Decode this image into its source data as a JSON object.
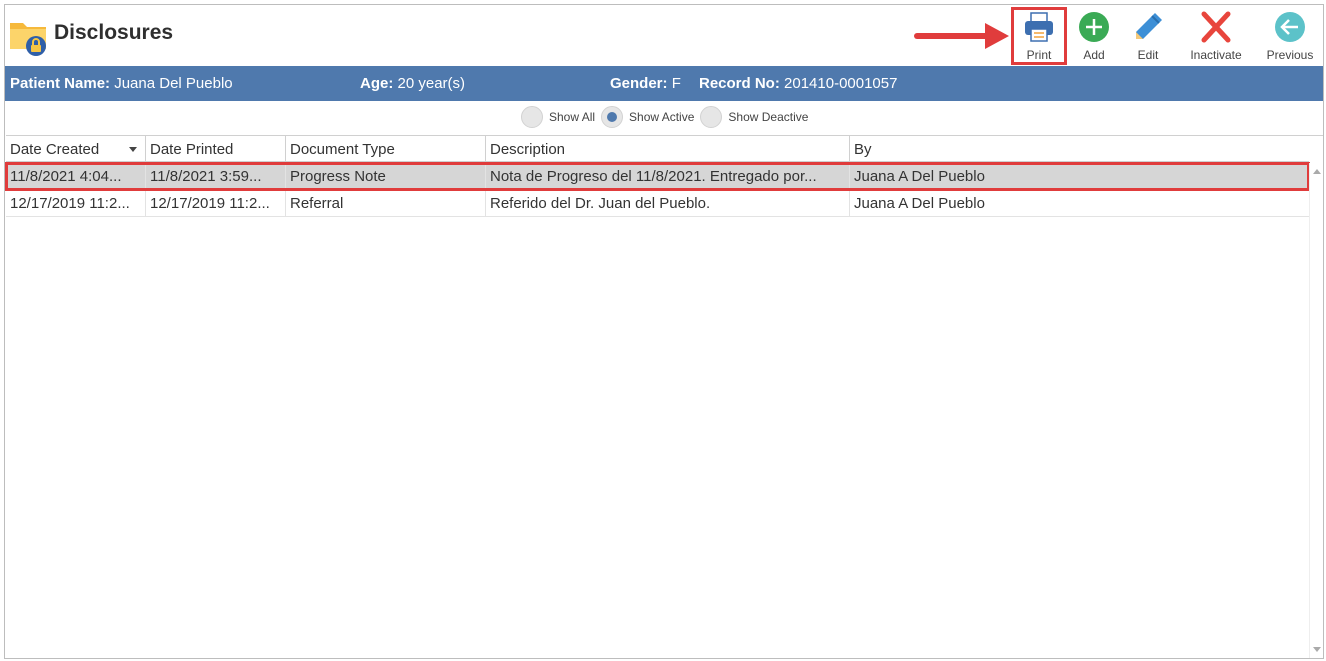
{
  "header": {
    "title": "Disclosures"
  },
  "toolbar": {
    "print_label": "Print",
    "add_label": "Add",
    "edit_label": "Edit",
    "inactivate_label": "Inactivate",
    "previous_label": "Previous",
    "icons": {
      "print": "printer-icon",
      "add": "plus-circle-icon",
      "edit": "pencil-icon",
      "inactivate": "x-icon",
      "previous": "arrow-left-circle-icon"
    }
  },
  "patient": {
    "name_label": "Patient Name:",
    "name_value": "Juana Del Pueblo",
    "age_label": "Age:",
    "age_value": "20 year(s)",
    "gender_label": "Gender:",
    "gender_value": "F",
    "record_label": "Record No:",
    "record_value": "201410-0001057"
  },
  "filters": {
    "options": [
      "Show All",
      "Show Active",
      "Show Deactive"
    ],
    "selected": "Show Active"
  },
  "grid": {
    "columns": [
      "Date Created",
      "Date Printed",
      "Document Type",
      "Description",
      "By"
    ],
    "rows": [
      [
        "11/8/2021 4:04...",
        "11/8/2021 3:59...",
        "Progress Note",
        "Nota de Progreso del 11/8/2021. Entregado por...",
        "Juana A Del Pueblo"
      ],
      [
        "12/17/2019 11:2...",
        "12/17/2019 11:2...",
        "Referral",
        "Referido del Dr. Juan del Pueblo.",
        "Juana A Del Pueblo"
      ]
    ],
    "selected_row": 0
  },
  "colors": {
    "accent": "#4f79ad",
    "highlight": "#e03c3c",
    "selected_row": "#d6d6d6"
  }
}
